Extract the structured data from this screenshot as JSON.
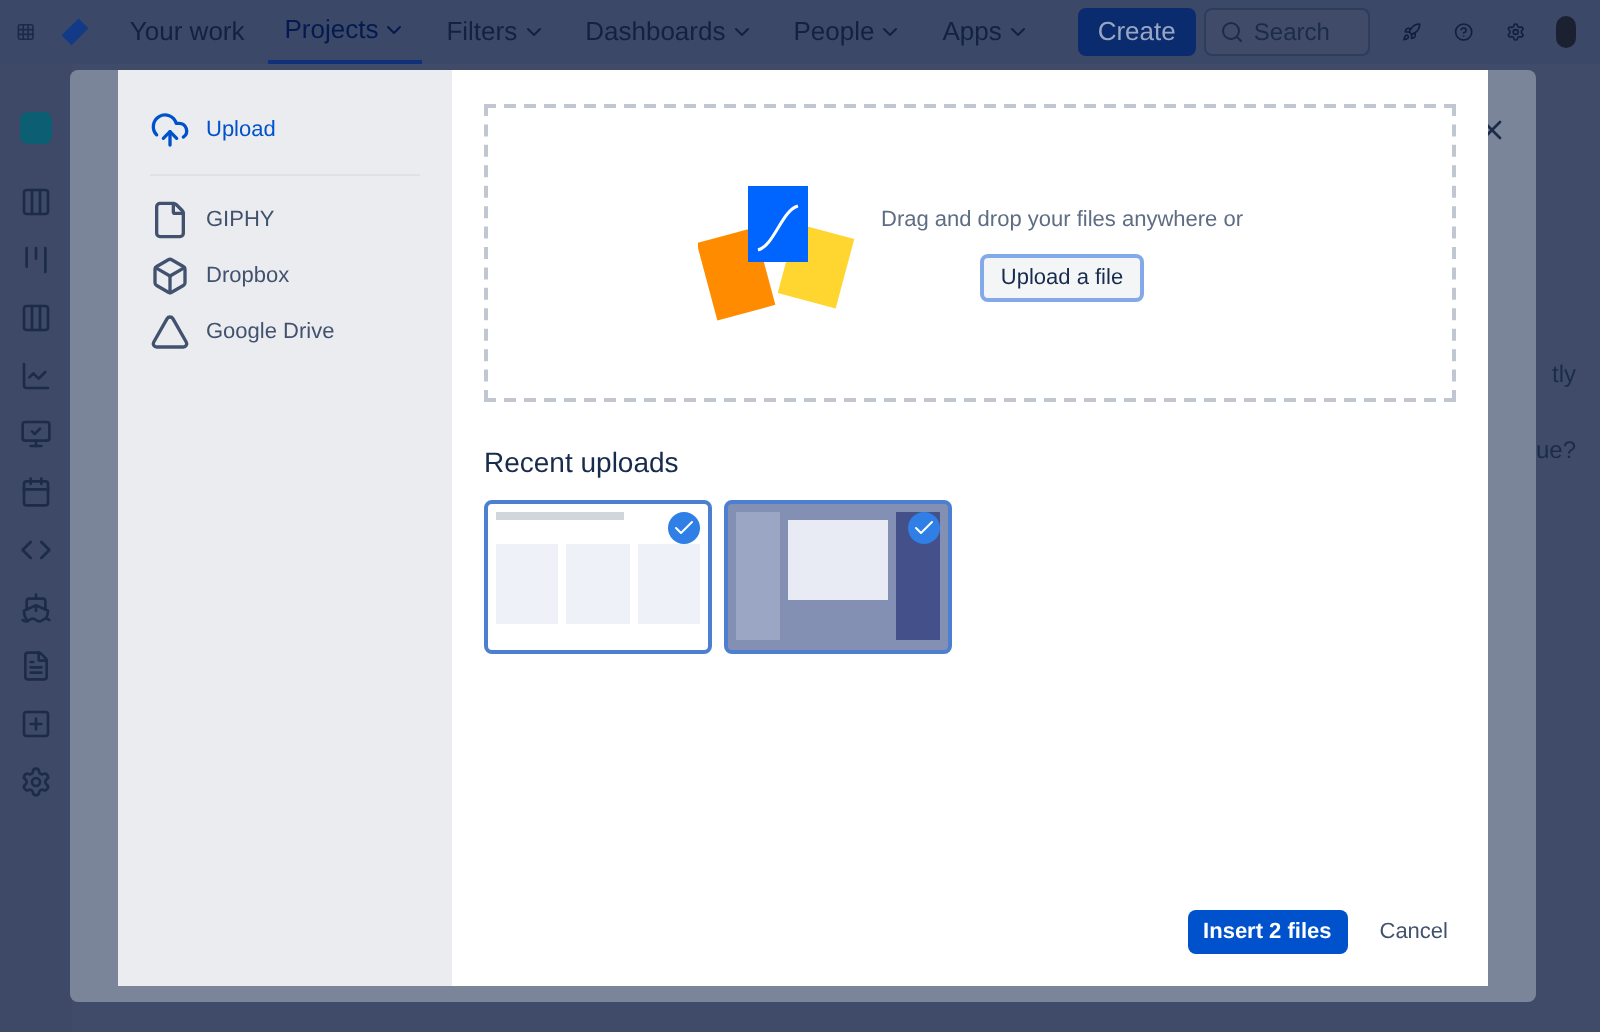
{
  "top_nav": {
    "items": [
      {
        "label": "Your work",
        "dropdown": false,
        "selected": false
      },
      {
        "label": "Projects",
        "dropdown": true,
        "selected": true
      },
      {
        "label": "Filters",
        "dropdown": true,
        "selected": false
      },
      {
        "label": "Dashboards",
        "dropdown": true,
        "selected": false
      },
      {
        "label": "People",
        "dropdown": true,
        "selected": false
      },
      {
        "label": "Apps",
        "dropdown": true,
        "selected": false
      }
    ],
    "create_button": "Create",
    "search": {
      "placeholder": "Search"
    }
  },
  "background_fragments": [
    "tly",
    "ue?"
  ],
  "dialog": {
    "sources": [
      {
        "label": "Upload",
        "kind": "upload",
        "selected": true
      },
      {
        "label": "GIPHY",
        "kind": "file",
        "selected": false
      },
      {
        "label": "Dropbox",
        "kind": "dropbox",
        "selected": false
      },
      {
        "label": "Google Drive",
        "kind": "drive",
        "selected": false
      }
    ],
    "dropzone": {
      "text": "Drag and drop your files anywhere or",
      "button": "Upload a file"
    },
    "recent_title": "Recent uploads",
    "recent": [
      {
        "kind": "light",
        "selected": true
      },
      {
        "kind": "dark",
        "selected": true
      }
    ],
    "insert_button": "Insert 2 files",
    "cancel_button": "Cancel"
  }
}
